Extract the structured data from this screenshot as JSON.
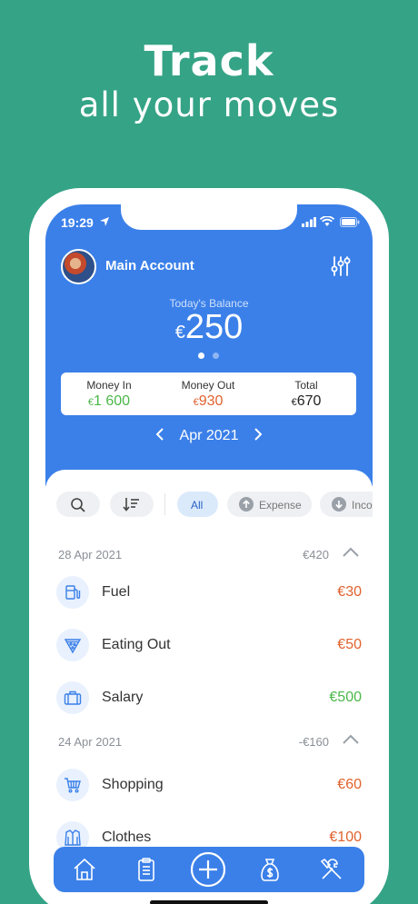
{
  "promo": {
    "title": "Track",
    "subtitle": "all your moves"
  },
  "status_bar": {
    "time": "19:29"
  },
  "account": {
    "name": "Main Account"
  },
  "balance": {
    "label": "Today's Balance",
    "currency": "€",
    "amount": "250"
  },
  "summary": {
    "money_in": {
      "label": "Money In",
      "currency": "€",
      "amount": "1 600"
    },
    "money_out": {
      "label": "Money Out",
      "currency": "€",
      "amount": "930"
    },
    "total": {
      "label": "Total",
      "currency": "€",
      "amount": "670"
    }
  },
  "month": "Apr 2021",
  "filters": {
    "all": "All",
    "expense": "Expense",
    "income": "Inco"
  },
  "groups": [
    {
      "date": "28 Apr 2021",
      "total": "€420",
      "items": [
        {
          "label": "Fuel",
          "amount": "€30",
          "icon": "fuel-icon"
        },
        {
          "label": "Eating Out",
          "amount": "€50",
          "icon": "pizza-icon"
        },
        {
          "label": "Salary",
          "amount": "€500",
          "icon": "briefcase-icon"
        }
      ]
    },
    {
      "date": "24 Apr 2021",
      "total": "-€160",
      "items": [
        {
          "label": "Shopping",
          "amount": "€60",
          "icon": "cart-icon"
        },
        {
          "label": "Clothes",
          "amount": "€100",
          "icon": "jacket-icon"
        }
      ]
    }
  ],
  "colors": {
    "background": "#35a386",
    "header": "#3b80e9",
    "income": "#4bb749",
    "expense": "#e0622e"
  }
}
